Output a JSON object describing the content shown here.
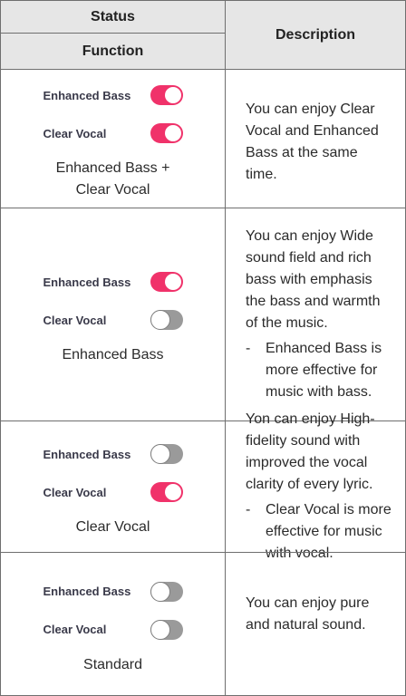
{
  "header": {
    "status": "Status",
    "function": "Function",
    "description": "Description"
  },
  "colors": {
    "toggle_on": "#f0326a",
    "toggle_off": "#9a9a9a",
    "header_bg": "#e6e6e6"
  },
  "rows": [
    {
      "toggles": [
        {
          "label": "Enhanced Bass",
          "state": "on"
        },
        {
          "label": "Clear Vocal",
          "state": "on"
        }
      ],
      "mode": "Enhanced Bass + Clear Vocal",
      "description": "You can enjoy Clear Vocal and Enhanced Bass at the same time.",
      "note": ""
    },
    {
      "toggles": [
        {
          "label": "Enhanced Bass",
          "state": "on"
        },
        {
          "label": "Clear Vocal",
          "state": "off"
        }
      ],
      "mode": "Enhanced Bass",
      "description": "You can enjoy Wide sound field and rich bass with emphasis the bass and warmth of the music.",
      "note": "Enhanced Bass is more effective for music with bass."
    },
    {
      "toggles": [
        {
          "label": "Enhanced Bass",
          "state": "off"
        },
        {
          "label": "Clear Vocal",
          "state": "on"
        }
      ],
      "mode": "Clear Vocal",
      "description": "Yon can enjoy High-fidelity sound with improved the vocal clarity of every lyric.",
      "note": "Clear Vocal is more effective for music with vocal."
    },
    {
      "toggles": [
        {
          "label": "Enhanced Bass",
          "state": "off"
        },
        {
          "label": "Clear Vocal",
          "state": "off"
        }
      ],
      "mode": "Standard",
      "description": "You can enjoy pure and natural sound.",
      "note": ""
    }
  ],
  "dash_symbol": "-"
}
